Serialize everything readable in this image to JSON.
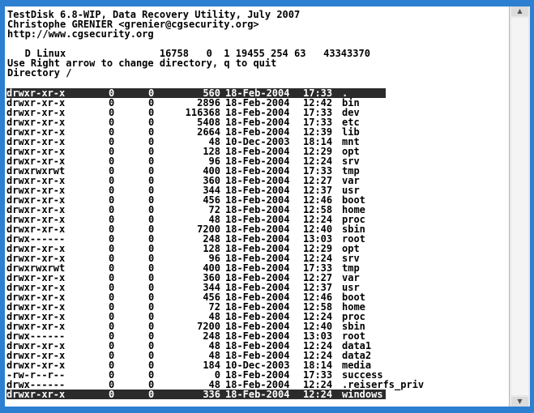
{
  "header": {
    "line1": "TestDisk 6.8-WIP, Data Recovery Utility, July 2007",
    "line2": "Christophe GRENIER <grenier@cgsecurity.org>",
    "line3": "http://www.cgsecurity.org",
    "partition": "   D Linux                16758   0  1 19455 254 63   43343370",
    "help_prefix": "Use ",
    "help_key1": "Right",
    "help_mid": " arrow to change directory, ",
    "help_key2": "q",
    "help_suffix": " to quit",
    "directory": "Directory /"
  },
  "files": [
    {
      "perm": "drwxr-xr-x",
      "uid": "0",
      "gid": "0",
      "size": "560",
      "date": "18-Feb-2004",
      "time": "17:33",
      "name": ".",
      "selected": true
    },
    {
      "perm": "drwxr-xr-x",
      "uid": "0",
      "gid": "0",
      "size": "2896",
      "date": "18-Feb-2004",
      "time": "12:42",
      "name": "bin"
    },
    {
      "perm": "drwxr-xr-x",
      "uid": "0",
      "gid": "0",
      "size": "116368",
      "date": "18-Feb-2004",
      "time": "17:33",
      "name": "dev"
    },
    {
      "perm": "drwxr-xr-x",
      "uid": "0",
      "gid": "0",
      "size": "5408",
      "date": "18-Feb-2004",
      "time": "17:33",
      "name": "etc"
    },
    {
      "perm": "drwxr-xr-x",
      "uid": "0",
      "gid": "0",
      "size": "2664",
      "date": "18-Feb-2004",
      "time": "12:39",
      "name": "lib"
    },
    {
      "perm": "drwxr-xr-x",
      "uid": "0",
      "gid": "0",
      "size": "48",
      "date": "10-Dec-2003",
      "time": "18:14",
      "name": "mnt"
    },
    {
      "perm": "drwxr-xr-x",
      "uid": "0",
      "gid": "0",
      "size": "128",
      "date": "18-Feb-2004",
      "time": "12:29",
      "name": "opt"
    },
    {
      "perm": "drwxr-xr-x",
      "uid": "0",
      "gid": "0",
      "size": "96",
      "date": "18-Feb-2004",
      "time": "12:24",
      "name": "srv"
    },
    {
      "perm": "drwxrwxrwt",
      "uid": "0",
      "gid": "0",
      "size": "400",
      "date": "18-Feb-2004",
      "time": "17:33",
      "name": "tmp"
    },
    {
      "perm": "drwxr-xr-x",
      "uid": "0",
      "gid": "0",
      "size": "360",
      "date": "18-Feb-2004",
      "time": "12:27",
      "name": "var"
    },
    {
      "perm": "drwxr-xr-x",
      "uid": "0",
      "gid": "0",
      "size": "344",
      "date": "18-Feb-2004",
      "time": "12:37",
      "name": "usr"
    },
    {
      "perm": "drwxr-xr-x",
      "uid": "0",
      "gid": "0",
      "size": "456",
      "date": "18-Feb-2004",
      "time": "12:46",
      "name": "boot"
    },
    {
      "perm": "drwxr-xr-x",
      "uid": "0",
      "gid": "0",
      "size": "72",
      "date": "18-Feb-2004",
      "time": "12:58",
      "name": "home"
    },
    {
      "perm": "drwxr-xr-x",
      "uid": "0",
      "gid": "0",
      "size": "48",
      "date": "18-Feb-2004",
      "time": "12:24",
      "name": "proc"
    },
    {
      "perm": "drwxr-xr-x",
      "uid": "0",
      "gid": "0",
      "size": "7200",
      "date": "18-Feb-2004",
      "time": "12:40",
      "name": "sbin"
    },
    {
      "perm": "drwx------",
      "uid": "0",
      "gid": "0",
      "size": "248",
      "date": "18-Feb-2004",
      "time": "13:03",
      "name": "root"
    },
    {
      "perm": "drwxr-xr-x",
      "uid": "0",
      "gid": "0",
      "size": "128",
      "date": "18-Feb-2004",
      "time": "12:29",
      "name": "opt"
    },
    {
      "perm": "drwxr-xr-x",
      "uid": "0",
      "gid": "0",
      "size": "96",
      "date": "18-Feb-2004",
      "time": "12:24",
      "name": "srv"
    },
    {
      "perm": "drwxrwxrwt",
      "uid": "0",
      "gid": "0",
      "size": "400",
      "date": "18-Feb-2004",
      "time": "17:33",
      "name": "tmp"
    },
    {
      "perm": "drwxr-xr-x",
      "uid": "0",
      "gid": "0",
      "size": "360",
      "date": "18-Feb-2004",
      "time": "12:27",
      "name": "var"
    },
    {
      "perm": "drwxr-xr-x",
      "uid": "0",
      "gid": "0",
      "size": "344",
      "date": "18-Feb-2004",
      "time": "12:37",
      "name": "usr"
    },
    {
      "perm": "drwxr-xr-x",
      "uid": "0",
      "gid": "0",
      "size": "456",
      "date": "18-Feb-2004",
      "time": "12:46",
      "name": "boot"
    },
    {
      "perm": "drwxr-xr-x",
      "uid": "0",
      "gid": "0",
      "size": "72",
      "date": "18-Feb-2004",
      "time": "12:58",
      "name": "home"
    },
    {
      "perm": "drwxr-xr-x",
      "uid": "0",
      "gid": "0",
      "size": "48",
      "date": "18-Feb-2004",
      "time": "12:24",
      "name": "proc"
    },
    {
      "perm": "drwxr-xr-x",
      "uid": "0",
      "gid": "0",
      "size": "7200",
      "date": "18-Feb-2004",
      "time": "12:40",
      "name": "sbin"
    },
    {
      "perm": "drwx------",
      "uid": "0",
      "gid": "0",
      "size": "248",
      "date": "18-Feb-2004",
      "time": "13:03",
      "name": "root"
    },
    {
      "perm": "drwxr-xr-x",
      "uid": "0",
      "gid": "0",
      "size": "48",
      "date": "18-Feb-2004",
      "time": "12:24",
      "name": "data1"
    },
    {
      "perm": "drwxr-xr-x",
      "uid": "0",
      "gid": "0",
      "size": "48",
      "date": "18-Feb-2004",
      "time": "12:24",
      "name": "data2"
    },
    {
      "perm": "drwxr-xr-x",
      "uid": "0",
      "gid": "0",
      "size": "184",
      "date": "10-Dec-2003",
      "time": "18:14",
      "name": "media"
    },
    {
      "perm": "-rw-r--r--",
      "uid": "0",
      "gid": "0",
      "size": "0",
      "date": "18-Feb-2004",
      "time": "17:33",
      "name": "success"
    },
    {
      "perm": "drwx------",
      "uid": "0",
      "gid": "0",
      "size": "48",
      "date": "18-Feb-2004",
      "time": "12:24",
      "name": ".reiserfs_priv"
    },
    {
      "perm": "drwxr-xr-x",
      "uid": "0",
      "gid": "0",
      "size": "336",
      "date": "18-Feb-2004",
      "time": "12:24",
      "name": "windows",
      "selected": true
    }
  ],
  "scrollbar": {
    "up_icon": "arrow-up-icon",
    "down_icon": "arrow-down-icon"
  },
  "colors": {
    "background": "#2d7fd1",
    "selected": "#2b2b2b"
  }
}
